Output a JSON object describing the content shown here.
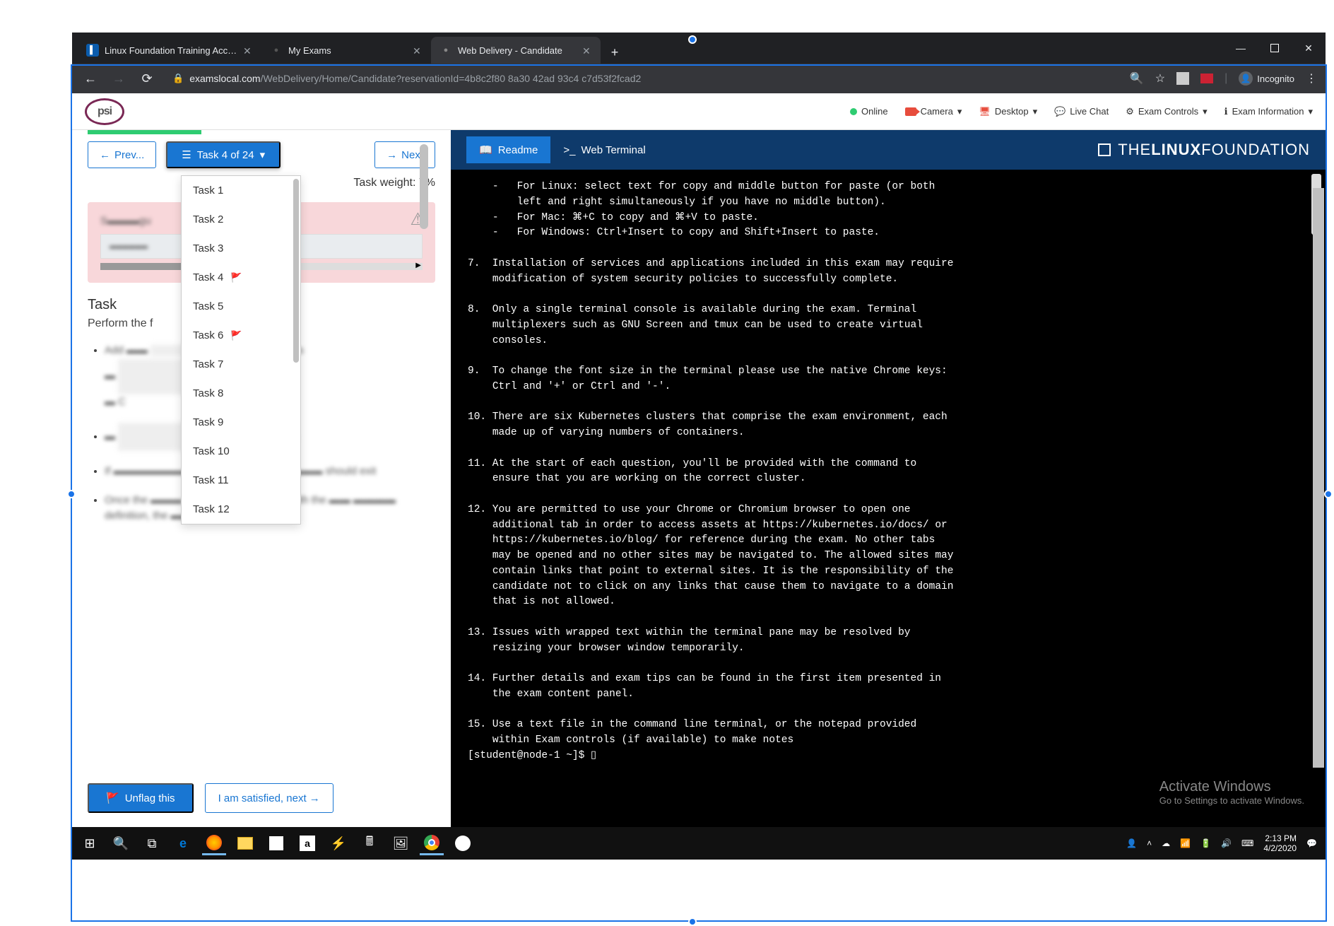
{
  "browser": {
    "tabs": [
      {
        "title": "Linux Foundation Training Acco...",
        "fav_bg": "#0b5cad",
        "fav_text": "📄"
      },
      {
        "title": "My Exams",
        "fav_bg": "#fff",
        "fav_text": "●"
      },
      {
        "title": "Web Delivery - Candidate",
        "fav_bg": "#fff",
        "fav_text": "●"
      }
    ],
    "url_host": "examslocal.com",
    "url_path": "/WebDelivery/Home/Candidate?reservationId=4b8c2f80 8a30 42ad 93c4 c7d53f2fcad2",
    "incognito": "Incognito"
  },
  "topbar": {
    "logo": "psi",
    "online": "Online",
    "camera": "Camera",
    "desktop": "Desktop",
    "livechat": "Live Chat",
    "examcontrols": "Exam Controls",
    "examinfo": "Exam Information"
  },
  "leftpanel": {
    "prev": "Prev...",
    "task_select": "Task 4 of 24",
    "next": "Next",
    "weight": "Task weight: 7%",
    "dropdown": [
      {
        "label": "Task 1",
        "flag": false
      },
      {
        "label": "Task 2",
        "flag": false
      },
      {
        "label": "Task 3",
        "flag": false
      },
      {
        "label": "Task 4",
        "flag": true
      },
      {
        "label": "Task 5",
        "flag": false
      },
      {
        "label": "Task 6",
        "flag": true
      },
      {
        "label": "Task 7",
        "flag": false
      },
      {
        "label": "Task 8",
        "flag": false
      },
      {
        "label": "Task 9",
        "flag": false
      },
      {
        "label": "Task 10",
        "flag": false
      },
      {
        "label": "Task 11",
        "flag": false
      },
      {
        "label": "Task 12",
        "flag": false
      }
    ],
    "task_heading": "Task",
    "task_sub": "Perform the f",
    "unflag": "Unflag this",
    "satisfied": "I am satisfied, next →"
  },
  "rightpanel": {
    "readme": "Readme",
    "terminal": "Web Terminal",
    "brand_the": "THE",
    "brand_linux": "LINUX",
    "brand_found": "FOUNDATION"
  },
  "terminal_text": "    -   For Linux: select text for copy and middle button for paste (or both\n        left and right simultaneously if you have no middle button).\n    -   For Mac: ⌘+C to copy and ⌘+V to paste.\n    -   For Windows: Ctrl+Insert to copy and Shift+Insert to paste.\n\n7.  Installation of services and applications included in this exam may require\n    modification of system security policies to successfully complete.\n\n8.  Only a single terminal console is available during the exam. Terminal\n    multiplexers such as GNU Screen and tmux can be used to create virtual\n    consoles.\n\n9.  To change the font size in the terminal please use the native Chrome keys:\n    Ctrl and '+' or Ctrl and '-'.\n\n10. There are six Kubernetes clusters that comprise the exam environment, each\n    made up of varying numbers of containers.\n\n11. At the start of each question, you'll be provided with the command to\n    ensure that you are working on the correct cluster.\n\n12. You are permitted to use your Chrome or Chromium browser to open one\n    additional tab in order to access assets at https://kubernetes.io/docs/ or\n    https://kubernetes.io/blog/ for reference during the exam. No other tabs\n    may be opened and no other sites may be navigated to. The allowed sites may\n    contain links that point to external sites. It is the responsibility of the\n    candidate not to click on any links that cause them to navigate to a domain\n    that is not allowed.\n\n13. Issues with wrapped text within the terminal pane may be resolved by\n    resizing your browser window temporarily.\n\n14. Further details and exam tips can be found in the first item presented in\n    the exam content panel.\n\n15. Use a text file in the command line terminal, or the notepad provided\n    within Exam controls (if available) to make notes\n[student@node-1 ~]$ ▯",
  "activate": {
    "t1": "Activate Windows",
    "t2": "Go to Settings to activate Windows."
  },
  "taskbar": {
    "time": "2:13 PM",
    "date": "4/2/2020"
  }
}
